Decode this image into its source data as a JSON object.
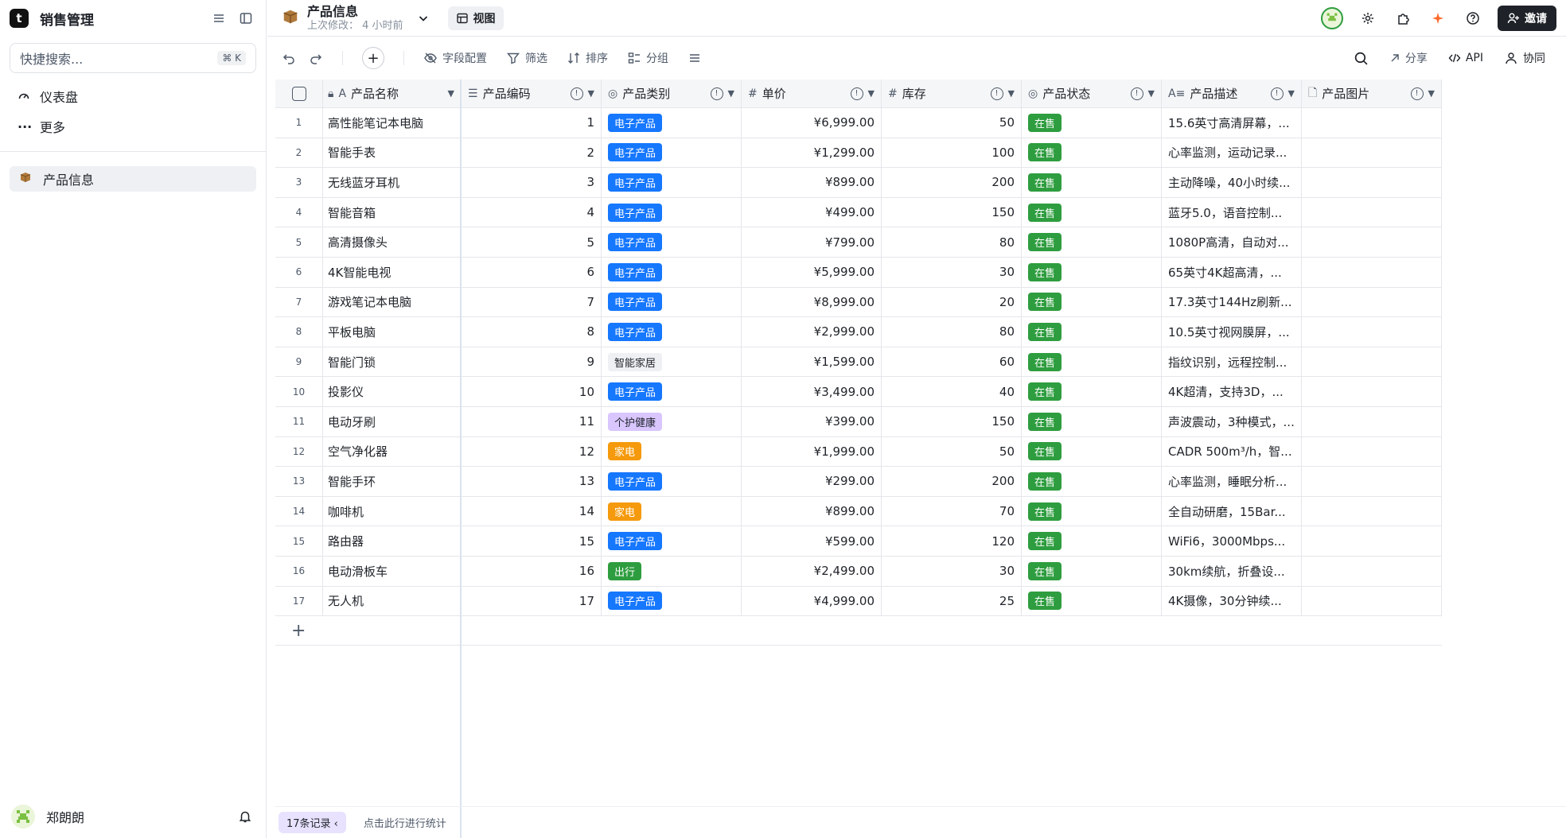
{
  "sidebar": {
    "logo": "t",
    "app_title": "销售管理",
    "search_placeholder": "快捷搜索...",
    "search_shortcut": "⌘ K",
    "nav": [
      {
        "label": "仪表盘",
        "icon": "gauge-icon"
      },
      {
        "label": "更多",
        "icon": "more-icon"
      }
    ],
    "tables": [
      {
        "label": "产品信息",
        "icon": "box-icon"
      }
    ],
    "user": {
      "name": "郑朗朗"
    }
  },
  "header": {
    "title": "产品信息",
    "subtitle": "上次修改： 4 小时前",
    "view_label": "视图",
    "invite_label": "邀请"
  },
  "toolbar": {
    "fields": "字段配置",
    "filter": "筛选",
    "sort": "排序",
    "group": "分组",
    "share": "分享",
    "api": "API",
    "collab": "协同"
  },
  "columns": [
    {
      "label": "产品名称",
      "icon": "text-icon"
    },
    {
      "label": "产品编码",
      "icon": "list-number-icon"
    },
    {
      "label": "产品类别",
      "icon": "select-icon"
    },
    {
      "label": "单价",
      "icon": "hash-icon"
    },
    {
      "label": "库存",
      "icon": "hash-icon"
    },
    {
      "label": "产品状态",
      "icon": "select-icon"
    },
    {
      "label": "产品描述",
      "icon": "longtext-icon"
    },
    {
      "label": "产品图片",
      "icon": "file-icon"
    }
  ],
  "category_colors": {
    "电子产品": "#1677ff",
    "智能家居": "#eef0f3",
    "个护健康": "#d9c6ff",
    "家电": "#f59a0c",
    "出行": "#2e9d3f"
  },
  "status_color": "#2e9d3f",
  "rows": [
    {
      "idx": "1",
      "name": "高性能笔记本电脑",
      "code": "1",
      "cat": "电子产品",
      "price": "¥6,999.00",
      "stock": "50",
      "status": "在售",
      "desc": "15.6英寸高清屏幕，..."
    },
    {
      "idx": "2",
      "name": "智能手表",
      "code": "2",
      "cat": "电子产品",
      "price": "¥1,299.00",
      "stock": "100",
      "status": "在售",
      "desc": "心率监测，运动记录..."
    },
    {
      "idx": "3",
      "name": "无线蓝牙耳机",
      "code": "3",
      "cat": "电子产品",
      "price": "¥899.00",
      "stock": "200",
      "status": "在售",
      "desc": "主动降噪，40小时续..."
    },
    {
      "idx": "4",
      "name": "智能音箱",
      "code": "4",
      "cat": "电子产品",
      "price": "¥499.00",
      "stock": "150",
      "status": "在售",
      "desc": "蓝牙5.0，语音控制..."
    },
    {
      "idx": "5",
      "name": "高清摄像头",
      "code": "5",
      "cat": "电子产品",
      "price": "¥799.00",
      "stock": "80",
      "status": "在售",
      "desc": "1080P高清，自动对..."
    },
    {
      "idx": "6",
      "name": "4K智能电视",
      "code": "6",
      "cat": "电子产品",
      "price": "¥5,999.00",
      "stock": "30",
      "status": "在售",
      "desc": "65英寸4K超高清，..."
    },
    {
      "idx": "7",
      "name": "游戏笔记本电脑",
      "code": "7",
      "cat": "电子产品",
      "price": "¥8,999.00",
      "stock": "20",
      "status": "在售",
      "desc": "17.3英寸144Hz刷新..."
    },
    {
      "idx": "8",
      "name": "平板电脑",
      "code": "8",
      "cat": "电子产品",
      "price": "¥2,999.00",
      "stock": "80",
      "status": "在售",
      "desc": "10.5英寸视网膜屏，..."
    },
    {
      "idx": "9",
      "name": "智能门锁",
      "code": "9",
      "cat": "智能家居",
      "price": "¥1,599.00",
      "stock": "60",
      "status": "在售",
      "desc": "指纹识别，远程控制..."
    },
    {
      "idx": "10",
      "name": "投影仪",
      "code": "10",
      "cat": "电子产品",
      "price": "¥3,499.00",
      "stock": "40",
      "status": "在售",
      "desc": "4K超清，支持3D，..."
    },
    {
      "idx": "11",
      "name": "电动牙刷",
      "code": "11",
      "cat": "个护健康",
      "price": "¥399.00",
      "stock": "150",
      "status": "在售",
      "desc": "声波震动，3种模式，..."
    },
    {
      "idx": "12",
      "name": "空气净化器",
      "code": "12",
      "cat": "家电",
      "price": "¥1,999.00",
      "stock": "50",
      "status": "在售",
      "desc": "CADR 500m³/h，智..."
    },
    {
      "idx": "13",
      "name": "智能手环",
      "code": "13",
      "cat": "电子产品",
      "price": "¥299.00",
      "stock": "200",
      "status": "在售",
      "desc": "心率监测，睡眠分析..."
    },
    {
      "idx": "14",
      "name": "咖啡机",
      "code": "14",
      "cat": "家电",
      "price": "¥899.00",
      "stock": "70",
      "status": "在售",
      "desc": "全自动研磨，15Bar..."
    },
    {
      "idx": "15",
      "name": "路由器",
      "code": "15",
      "cat": "电子产品",
      "price": "¥599.00",
      "stock": "120",
      "status": "在售",
      "desc": "WiFi6，3000Mbps..."
    },
    {
      "idx": "16",
      "name": "电动滑板车",
      "code": "16",
      "cat": "出行",
      "price": "¥2,499.00",
      "stock": "30",
      "status": "在售",
      "desc": "30km续航，折叠设..."
    },
    {
      "idx": "17",
      "name": "无人机",
      "code": "17",
      "cat": "电子产品",
      "price": "¥4,999.00",
      "stock": "25",
      "status": "在售",
      "desc": "4K摄像，30分钟续..."
    }
  ],
  "footer": {
    "record_count": "17条记录",
    "stat_hint": "点击此行进行统计"
  }
}
